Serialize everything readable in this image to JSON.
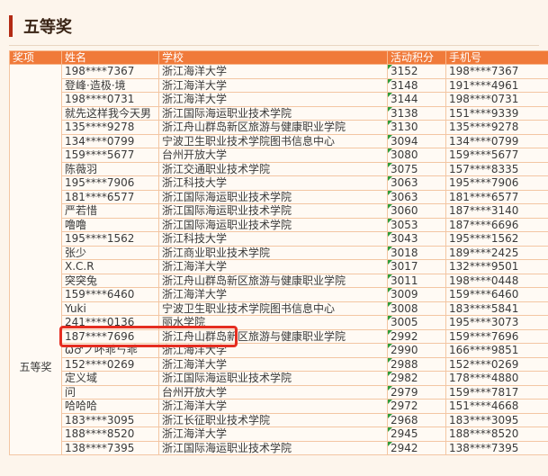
{
  "section_title": "五等奖",
  "columns": [
    "奖项",
    "姓名",
    "学校",
    "活动积分",
    "手机号"
  ],
  "level_label": "五等奖",
  "highlight_color": "#e52d20",
  "header_color": "#f07a3a",
  "rows": [
    {
      "name": "198****7367",
      "school": "浙江海洋大学",
      "score": "3152",
      "phone": "198****7367"
    },
    {
      "name": "登峰·造极·境",
      "school": "浙江海洋大学",
      "score": "3148",
      "phone": "191****4961"
    },
    {
      "name": "198****0731",
      "school": "浙江海洋大学",
      "score": "3144",
      "phone": "198****0731"
    },
    {
      "name": "就先这样我今天男",
      "school": "浙江国际海运职业技术学院",
      "score": "3138",
      "phone": "151****9339"
    },
    {
      "name": "135****9278",
      "school": "浙江舟山群岛新区旅游与健康职业学院",
      "score": "3130",
      "phone": "135****9278"
    },
    {
      "name": "134****0799",
      "school": "宁波卫生职业技术学院图书信息中心",
      "score": "3094",
      "phone": "134****0799"
    },
    {
      "name": "159****5677",
      "school": "台州开放大学",
      "score": "3080",
      "phone": "159****5677"
    },
    {
      "name": "陈薇羽",
      "school": "浙江交通职业技术学院",
      "score": "3075",
      "phone": "157****8335"
    },
    {
      "name": "195****7906",
      "school": "浙江科技大学",
      "score": "3063",
      "phone": "195****7906"
    },
    {
      "name": "181****6577",
      "school": "浙江国际海运职业技术学院",
      "score": "3063",
      "phone": "181****6577"
    },
    {
      "name": "严若惜",
      "school": "浙江国际海运职业技术学院",
      "score": "3060",
      "phone": "187****3140"
    },
    {
      "name": "噜噜",
      "school": "浙江国际海运职业技术学院",
      "score": "3053",
      "phone": "187****6696"
    },
    {
      "name": "195****1562",
      "school": "浙江科技大学",
      "score": "3043",
      "phone": "195****1562"
    },
    {
      "name": "张少",
      "school": "浙江商业职业技术学院",
      "score": "3018",
      "phone": "189****2425"
    },
    {
      "name": "X.C.R",
      "school": "浙江海洋大学",
      "score": "3017",
      "phone": "132****9501"
    },
    {
      "name": "突突兔",
      "school": "浙江舟山群岛新区旅游与健康职业学院",
      "score": "3011",
      "phone": "198****0448"
    },
    {
      "name": "159****6460",
      "school": "浙江海洋大学",
      "score": "3009",
      "phone": "159****6460"
    },
    {
      "name": "Yuki",
      "school": "宁波卫生职业技术学院图书信息中心",
      "score": "3008",
      "phone": "183****5841"
    },
    {
      "name": "241****0136",
      "school": "丽水学院",
      "score": "3005",
      "phone": "195****3073"
    },
    {
      "name": "187****7696",
      "school": "浙江舟山群岛新区旅游与健康职业学院",
      "score": "2992",
      "phone": "159****7696"
    },
    {
      "name": "ω♂ノ吥乖ㄣ乖",
      "school": "浙江海洋大学",
      "score": "2990",
      "phone": "166****9851"
    },
    {
      "name": "152****0269",
      "school": "浙江海洋大学",
      "score": "2988",
      "phone": "152****0269"
    },
    {
      "name": "定义域",
      "school": "浙江国际海运职业技术学院",
      "score": "2982",
      "phone": "178****4880"
    },
    {
      "name": "问",
      "school": "台州开放大学",
      "score": "2979",
      "phone": "159****7817"
    },
    {
      "name": "哈哈哈",
      "school": "浙江海洋大学",
      "score": "2972",
      "phone": "151****4668"
    },
    {
      "name": "183****3095",
      "school": "浙江长征职业技术学院",
      "score": "2968",
      "phone": "183****3095"
    },
    {
      "name": "188****8520",
      "school": "浙江海洋大学",
      "score": "2945",
      "phone": "188****8520"
    },
    {
      "name": "138****7395",
      "school": "浙江国际海运职业技术学院",
      "score": "2942",
      "phone": "138****7395"
    }
  ]
}
